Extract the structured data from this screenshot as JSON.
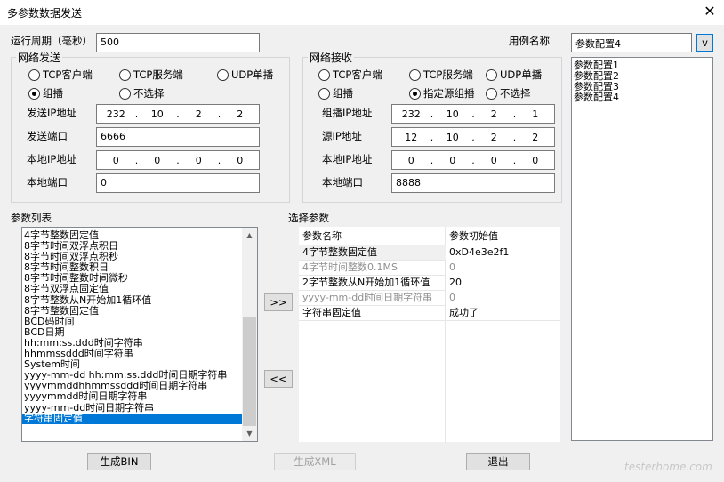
{
  "window": {
    "title": "多参数数据发送",
    "close": "✕"
  },
  "period": {
    "label": "运行周期（毫秒）",
    "value": "500"
  },
  "casename": {
    "label": "用例名称",
    "value": "参数配置4",
    "btn": "v"
  },
  "send": {
    "title": "网络发送",
    "radios": [
      "TCP客户端",
      "TCP服务端",
      "UDP单播",
      "组播",
      "不选择"
    ],
    "selected": "组播",
    "ip_label": "发送IP地址",
    "ip": [
      "232",
      "10",
      "2",
      "2"
    ],
    "port_label": "发送端口",
    "port": "6666",
    "local_ip_label": "本地IP地址",
    "local_ip": [
      "0",
      "0",
      "0",
      "0"
    ],
    "local_port_label": "本地端口",
    "local_port": "0"
  },
  "recv": {
    "title": "网络接收",
    "radios": [
      "TCP客户端",
      "TCP服务端",
      "UDP单播",
      "组播",
      "指定源组播",
      "不选择"
    ],
    "selected": "指定源组播",
    "mcast_label": "组播IP地址",
    "mcast_ip": [
      "232",
      "10",
      "2",
      "1"
    ],
    "src_label": "源IP地址",
    "src_ip": [
      "12",
      "10",
      "2",
      "2"
    ],
    "local_ip_label": "本地IP地址",
    "local_ip": [
      "0",
      "0",
      "0",
      "0"
    ],
    "local_port_label": "本地端口",
    "local_port": "8888"
  },
  "configs": [
    "参数配置1",
    "参数配置2",
    "参数配置3",
    "参数配置4"
  ],
  "param_list": {
    "label": "参数列表",
    "items": [
      "4字节整数固定值",
      "8字节时间双浮点积日",
      "8字节时间双浮点积秒",
      "8字节时间整数积日",
      "8字节时间整数时间微秒",
      "8字节双浮点固定值",
      "8字节整数从N开始加1循环值",
      "8字节整数固定值",
      "BCD码时间",
      "BCD日期",
      "hh:mm:ss.ddd时间字符串",
      "hhmmssddd时间字符串",
      "System时间",
      "yyyy-mm-dd hh:mm:ss.ddd时间日期字符串",
      "yyyymmddhhmmssddd时间日期字符串",
      "yyyymmdd时间日期字符串",
      "yyyy-mm-dd时间日期字符串",
      "字符串固定值"
    ],
    "selected": 17
  },
  "selected_params": {
    "label": "选择参数",
    "headers": [
      "参数名称",
      "参数初始值"
    ],
    "rows": [
      {
        "name": "4字节整数固定值",
        "value": "0xD4e3e2f1",
        "disabled": false
      },
      {
        "name": "4字节时间整数0.1MS",
        "value": "0",
        "disabled": true
      },
      {
        "name": "2字节整数从N开始加1循环值",
        "value": "20",
        "disabled": false
      },
      {
        "name": "yyyy-mm-dd时间日期字符串",
        "value": "0",
        "disabled": true
      },
      {
        "name": "字符串固定值",
        "value": "成功了",
        "disabled": false
      }
    ]
  },
  "buttons": {
    "add": ">>",
    "remove": "<<",
    "gen_bin": "生成BIN",
    "gen_xml": "生成XML",
    "exit": "退出"
  },
  "watermark": "testerhome.com"
}
